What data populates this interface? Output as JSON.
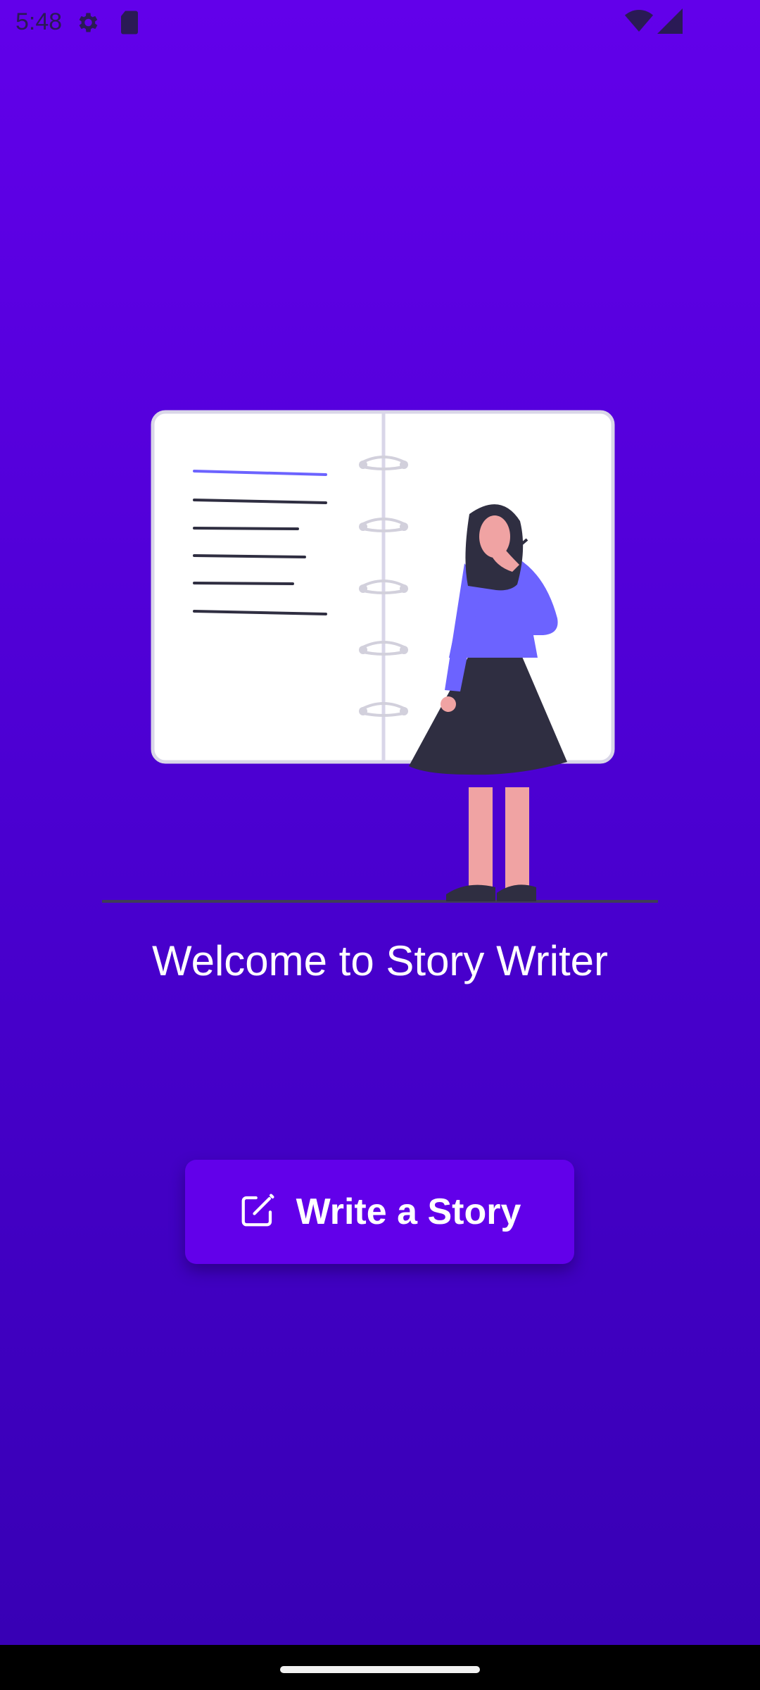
{
  "status_bar": {
    "time": "5:48",
    "icons": [
      "settings-icon",
      "sd-card-icon",
      "wifi-icon",
      "signal-icon"
    ]
  },
  "illustration": {
    "name": "woman-with-notebook",
    "colors": {
      "accent": "#6C63FF",
      "skirt": "#2F2E41",
      "skin": "#F0A3A3",
      "page": "#FFFFFF"
    }
  },
  "welcome": {
    "title": "Welcome to Story Writer"
  },
  "cta": {
    "label": "Write a Story",
    "icon": "edit-icon"
  },
  "colors": {
    "primary": "#6200EA",
    "background_top": "#6200EA",
    "background_bottom": "#3700B3"
  }
}
